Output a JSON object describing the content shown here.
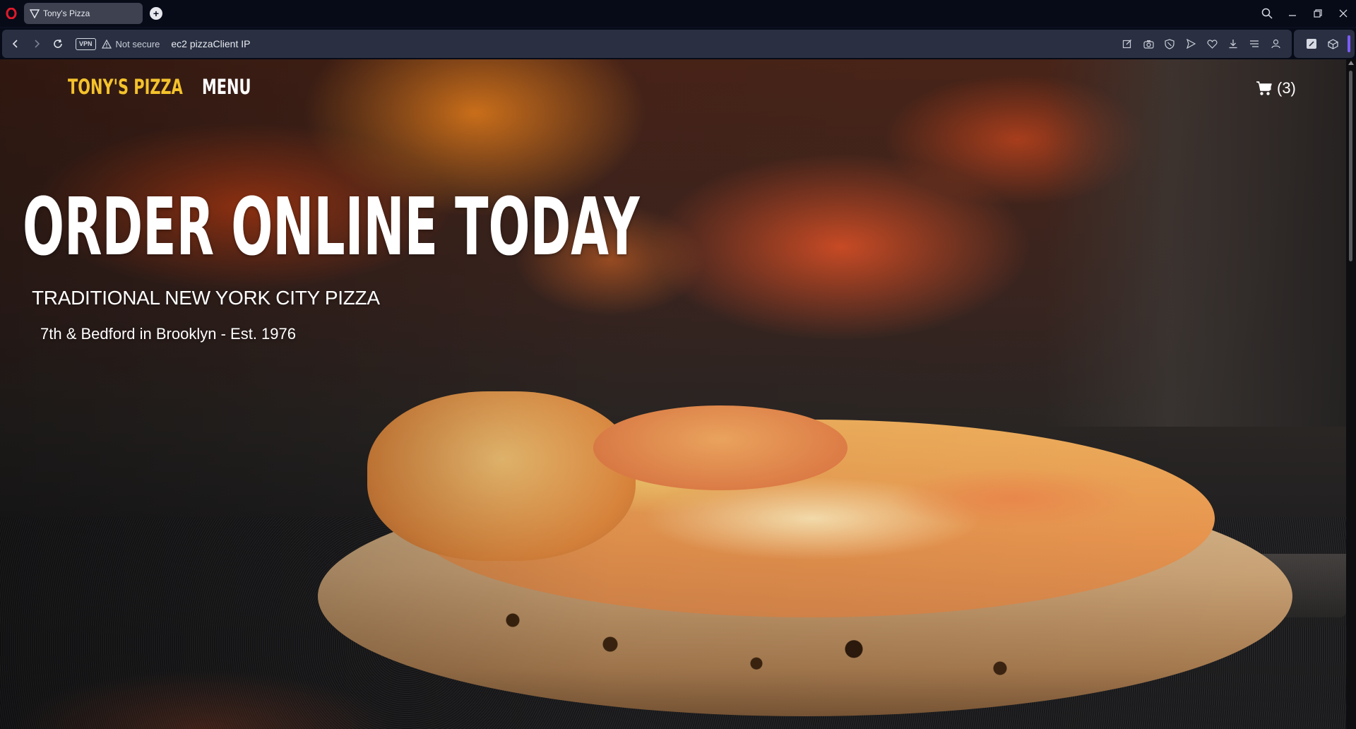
{
  "browser": {
    "tab_title": "Tony's Pizza",
    "vpn_label": "VPN",
    "security_text": "Not secure",
    "url": "ec2 pizzaClient IP"
  },
  "site": {
    "brand": "TONY'S PIZZA",
    "menu_label": "MENU",
    "cart_count": "(3)"
  },
  "hero": {
    "title": "ORDER ONLINE TODAY",
    "subtitle": "TRADITIONAL NEW YORK CITY PIZZA",
    "location": "7th & Bedford in Brooklyn - Est. 1976"
  },
  "colors": {
    "brand": "#f4c22b",
    "chrome_bg": "#070b18",
    "addressbar_bg": "#2a3042"
  },
  "icons": [
    "opera-logo-icon",
    "tab-favicon-icon",
    "new-tab-icon",
    "search-icon",
    "minimize-icon",
    "restore-icon",
    "close-icon",
    "back-icon",
    "forward-icon",
    "reload-icon",
    "warning-icon",
    "edit-icon",
    "camera-icon",
    "shield-icon",
    "send-icon",
    "heart-icon",
    "download-icon",
    "menu-icon",
    "profile-icon",
    "extension-icon",
    "cube-icon",
    "cart-icon"
  ]
}
